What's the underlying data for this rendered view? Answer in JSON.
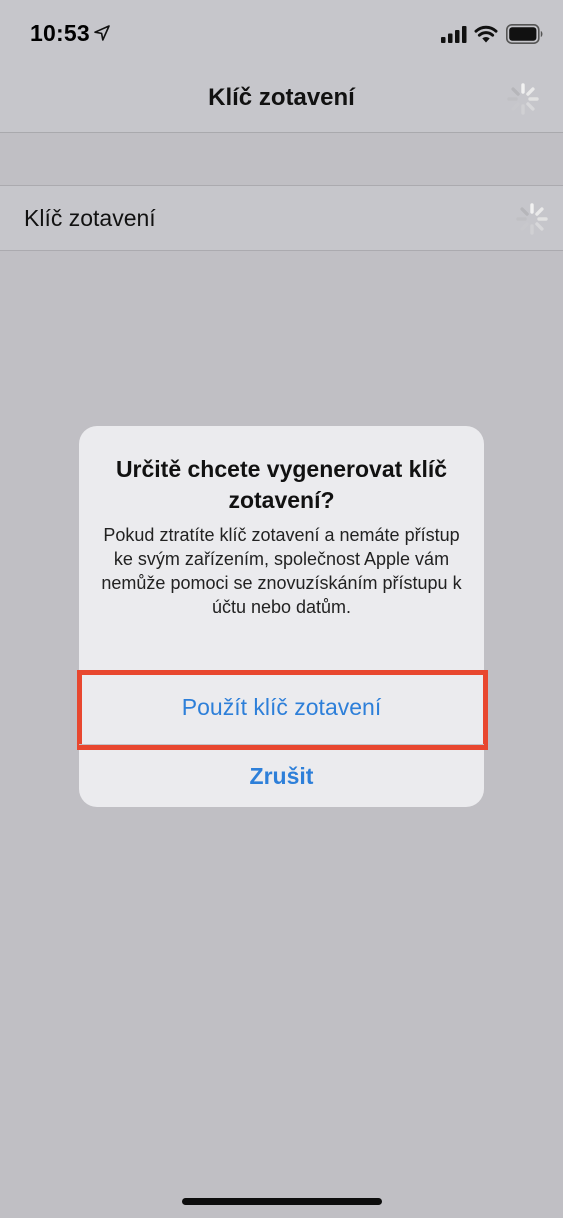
{
  "status_bar": {
    "time": "10:53",
    "icons": [
      "location-arrow-icon",
      "cellular-signal-icon",
      "wifi-icon",
      "battery-icon"
    ]
  },
  "nav": {
    "title": "Klíč zotavení",
    "activity_icon": "activity-spinner-icon"
  },
  "settings_row": {
    "label": "Klíč zotavení",
    "activity_icon": "activity-spinner-icon"
  },
  "alert": {
    "title": "Určitě chcete vygenerovat klíč zotavení?",
    "message": "Pokud ztratíte klíč zotavení a nemáte přístup ke svým zařízením, společnost Apple vám nemůže pomoci se znovuzískáním přístupu k účtu nebo datům.",
    "primary_button": "Použít klíč zotavení",
    "cancel_button": "Zrušit"
  },
  "colors": {
    "accent": "#2d7fd9",
    "highlight": "#e8472f",
    "dimmed_background": "#c0bfc4",
    "alert_background": "#ebebee"
  }
}
